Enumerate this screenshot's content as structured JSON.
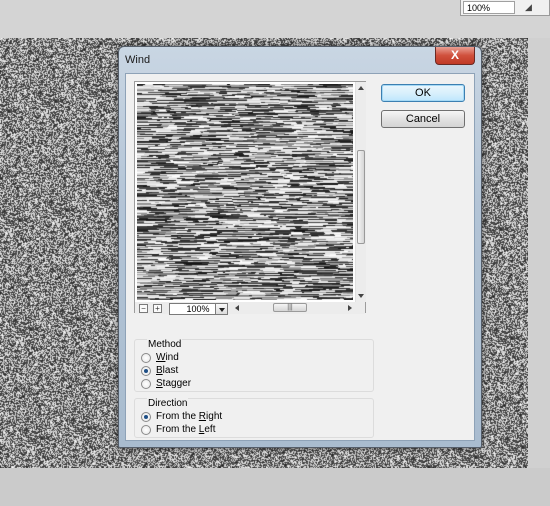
{
  "app": {
    "zoom_value": "100%",
    "zoom_icon": "zoom-slider-icon"
  },
  "dialog": {
    "title": "Wind",
    "close_label": "X",
    "ok_label": "OK",
    "cancel_label": "Cancel",
    "preview": {
      "zoom_out": "−",
      "zoom_in": "+",
      "zoom_value": "100%",
      "hscroll_grip": "|||"
    },
    "method": {
      "label": "Method",
      "options": [
        {
          "pre": "",
          "u": "W",
          "post": "ind",
          "checked": false
        },
        {
          "pre": "",
          "u": "B",
          "post": "last",
          "checked": true
        },
        {
          "pre": "",
          "u": "S",
          "post": "tagger",
          "checked": false
        }
      ]
    },
    "direction": {
      "label": "Direction",
      "options": [
        {
          "pre": "From the ",
          "u": "R",
          "post": "ight",
          "checked": true
        },
        {
          "pre": "From the ",
          "u": "L",
          "post": "eft",
          "checked": false
        }
      ]
    }
  },
  "colors": {
    "accent": "#3c7fb1",
    "close": "#c03a26"
  }
}
